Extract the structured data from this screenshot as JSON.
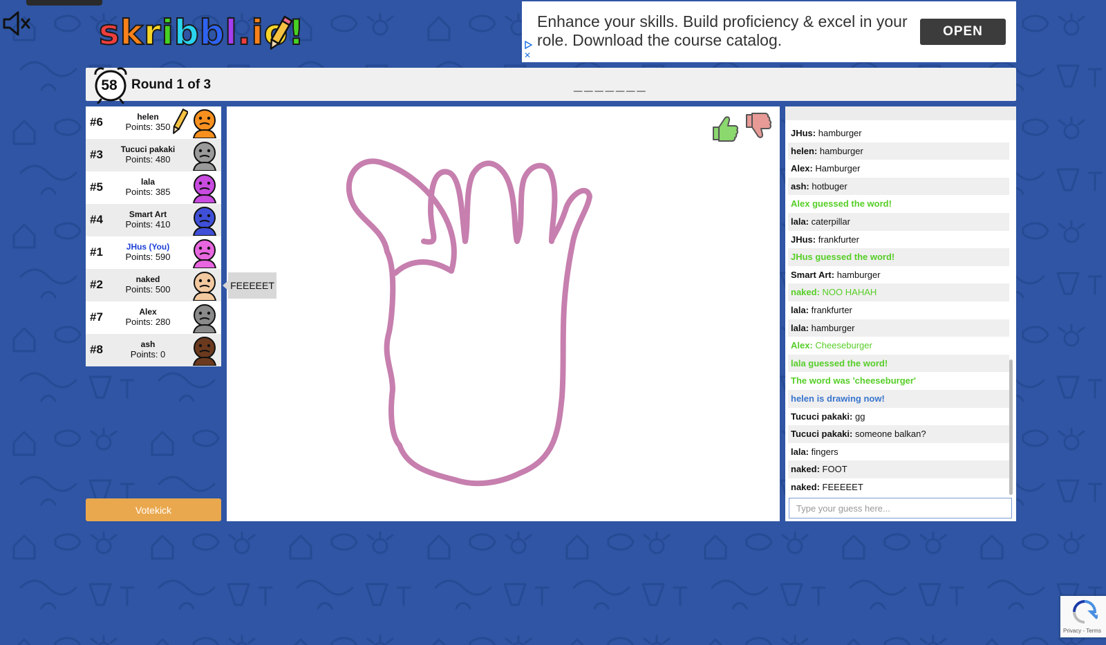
{
  "logo": {
    "letters": [
      "s",
      "k",
      "r",
      "i",
      "b",
      "b",
      "l",
      ".",
      "i",
      "o",
      "!"
    ],
    "colors": [
      "#ee3e3e",
      "#f9811a",
      "#f6d427",
      "#47d122",
      "#2bd3ee",
      "#2e62f0",
      "#a43ef0",
      "#ee3e3e",
      "#f9811a",
      "#f6d427",
      "#47d122"
    ]
  },
  "ad": {
    "text": "Enhance your skills. Build proficiency & excel in your role. Download the course catalog.",
    "button_label": "OPEN",
    "close_glyph": "✕"
  },
  "header": {
    "timer": "58",
    "round_text": "Round 1 of 3",
    "word_hint": "_______"
  },
  "players": [
    {
      "rank": "#6",
      "name": "helen",
      "points": "Points: 350",
      "avatar_color": "#f7901e",
      "drawing": true,
      "you": false
    },
    {
      "rank": "#3",
      "name": "Tucuci pakaki",
      "points": "Points: 480",
      "avatar_color": "#9a9a9a",
      "drawing": false,
      "you": false
    },
    {
      "rank": "#5",
      "name": "lala",
      "points": "Points: 385",
      "avatar_color": "#c94be0",
      "drawing": false,
      "you": false
    },
    {
      "rank": "#4",
      "name": "Smart Art",
      "points": "Points: 410",
      "avatar_color": "#3f4fd8",
      "drawing": false,
      "you": false
    },
    {
      "rank": "#1",
      "name": "JHus (You)",
      "points": "Points: 590",
      "avatar_color": "#e866e0",
      "drawing": false,
      "you": true
    },
    {
      "rank": "#2",
      "name": "naked",
      "points": "Points: 500",
      "avatar_color": "#f3c9a0",
      "drawing": false,
      "you": false
    },
    {
      "rank": "#7",
      "name": "Alex",
      "points": "Points: 280",
      "avatar_color": "#8a8a8a",
      "drawing": false,
      "you": false
    },
    {
      "rank": "#8",
      "name": "ash",
      "points": "Points: 0",
      "avatar_color": "#6b3a1e",
      "drawing": false,
      "you": false
    }
  ],
  "speech_bubble": {
    "text": "FEEEEET"
  },
  "votekick_label": "Votekick",
  "canvas": {
    "stroke_color": "#c67fae"
  },
  "chat": {
    "messages": [
      {
        "who": "JHus:",
        "text": "hamburger",
        "style": "normal"
      },
      {
        "who": "helen:",
        "text": "hamburger",
        "style": "normal"
      },
      {
        "who": "Alex:",
        "text": "Hamburger",
        "style": "normal"
      },
      {
        "who": "ash:",
        "text": "hotbuger",
        "style": "normal"
      },
      {
        "who": "",
        "text": "Alex guessed the word!",
        "style": "green"
      },
      {
        "who": "lala:",
        "text": "caterpillar",
        "style": "normal"
      },
      {
        "who": "JHus:",
        "text": "frankfurter",
        "style": "normal"
      },
      {
        "who": "",
        "text": "JHus guessed the word!",
        "style": "green"
      },
      {
        "who": "Smart Art:",
        "text": "hamburger",
        "style": "normal"
      },
      {
        "who": "naked:",
        "text": "NOO HAHAH",
        "style": "greenmsg"
      },
      {
        "who": "lala:",
        "text": "frankfurter",
        "style": "normal"
      },
      {
        "who": "lala:",
        "text": "hamburger",
        "style": "normal"
      },
      {
        "who": "Alex:",
        "text": "Cheeseburger",
        "style": "greenmsg"
      },
      {
        "who": "",
        "text": "lala guessed the word!",
        "style": "green"
      },
      {
        "who": "",
        "text": "The word was 'cheeseburger'",
        "style": "green"
      },
      {
        "who": "",
        "text": "helen is drawing now!",
        "style": "blue"
      },
      {
        "who": "Tucuci pakaki:",
        "text": "gg",
        "style": "normal"
      },
      {
        "who": "Tucuci pakaki:",
        "text": "someone balkan?",
        "style": "normal"
      },
      {
        "who": "lala:",
        "text": "fingers",
        "style": "normal"
      },
      {
        "who": "naked:",
        "text": "FOOT",
        "style": "normal"
      },
      {
        "who": "naked:",
        "text": "FEEEEET",
        "style": "normal"
      }
    ],
    "input_placeholder": "Type your guess here..."
  },
  "recaptcha": {
    "text": "Privacy - Terms"
  },
  "colors": {
    "background": "#2f55a4",
    "accent_green": "#56ce27",
    "accent_blue": "#3975ce",
    "votekick": "#eaa84e"
  }
}
